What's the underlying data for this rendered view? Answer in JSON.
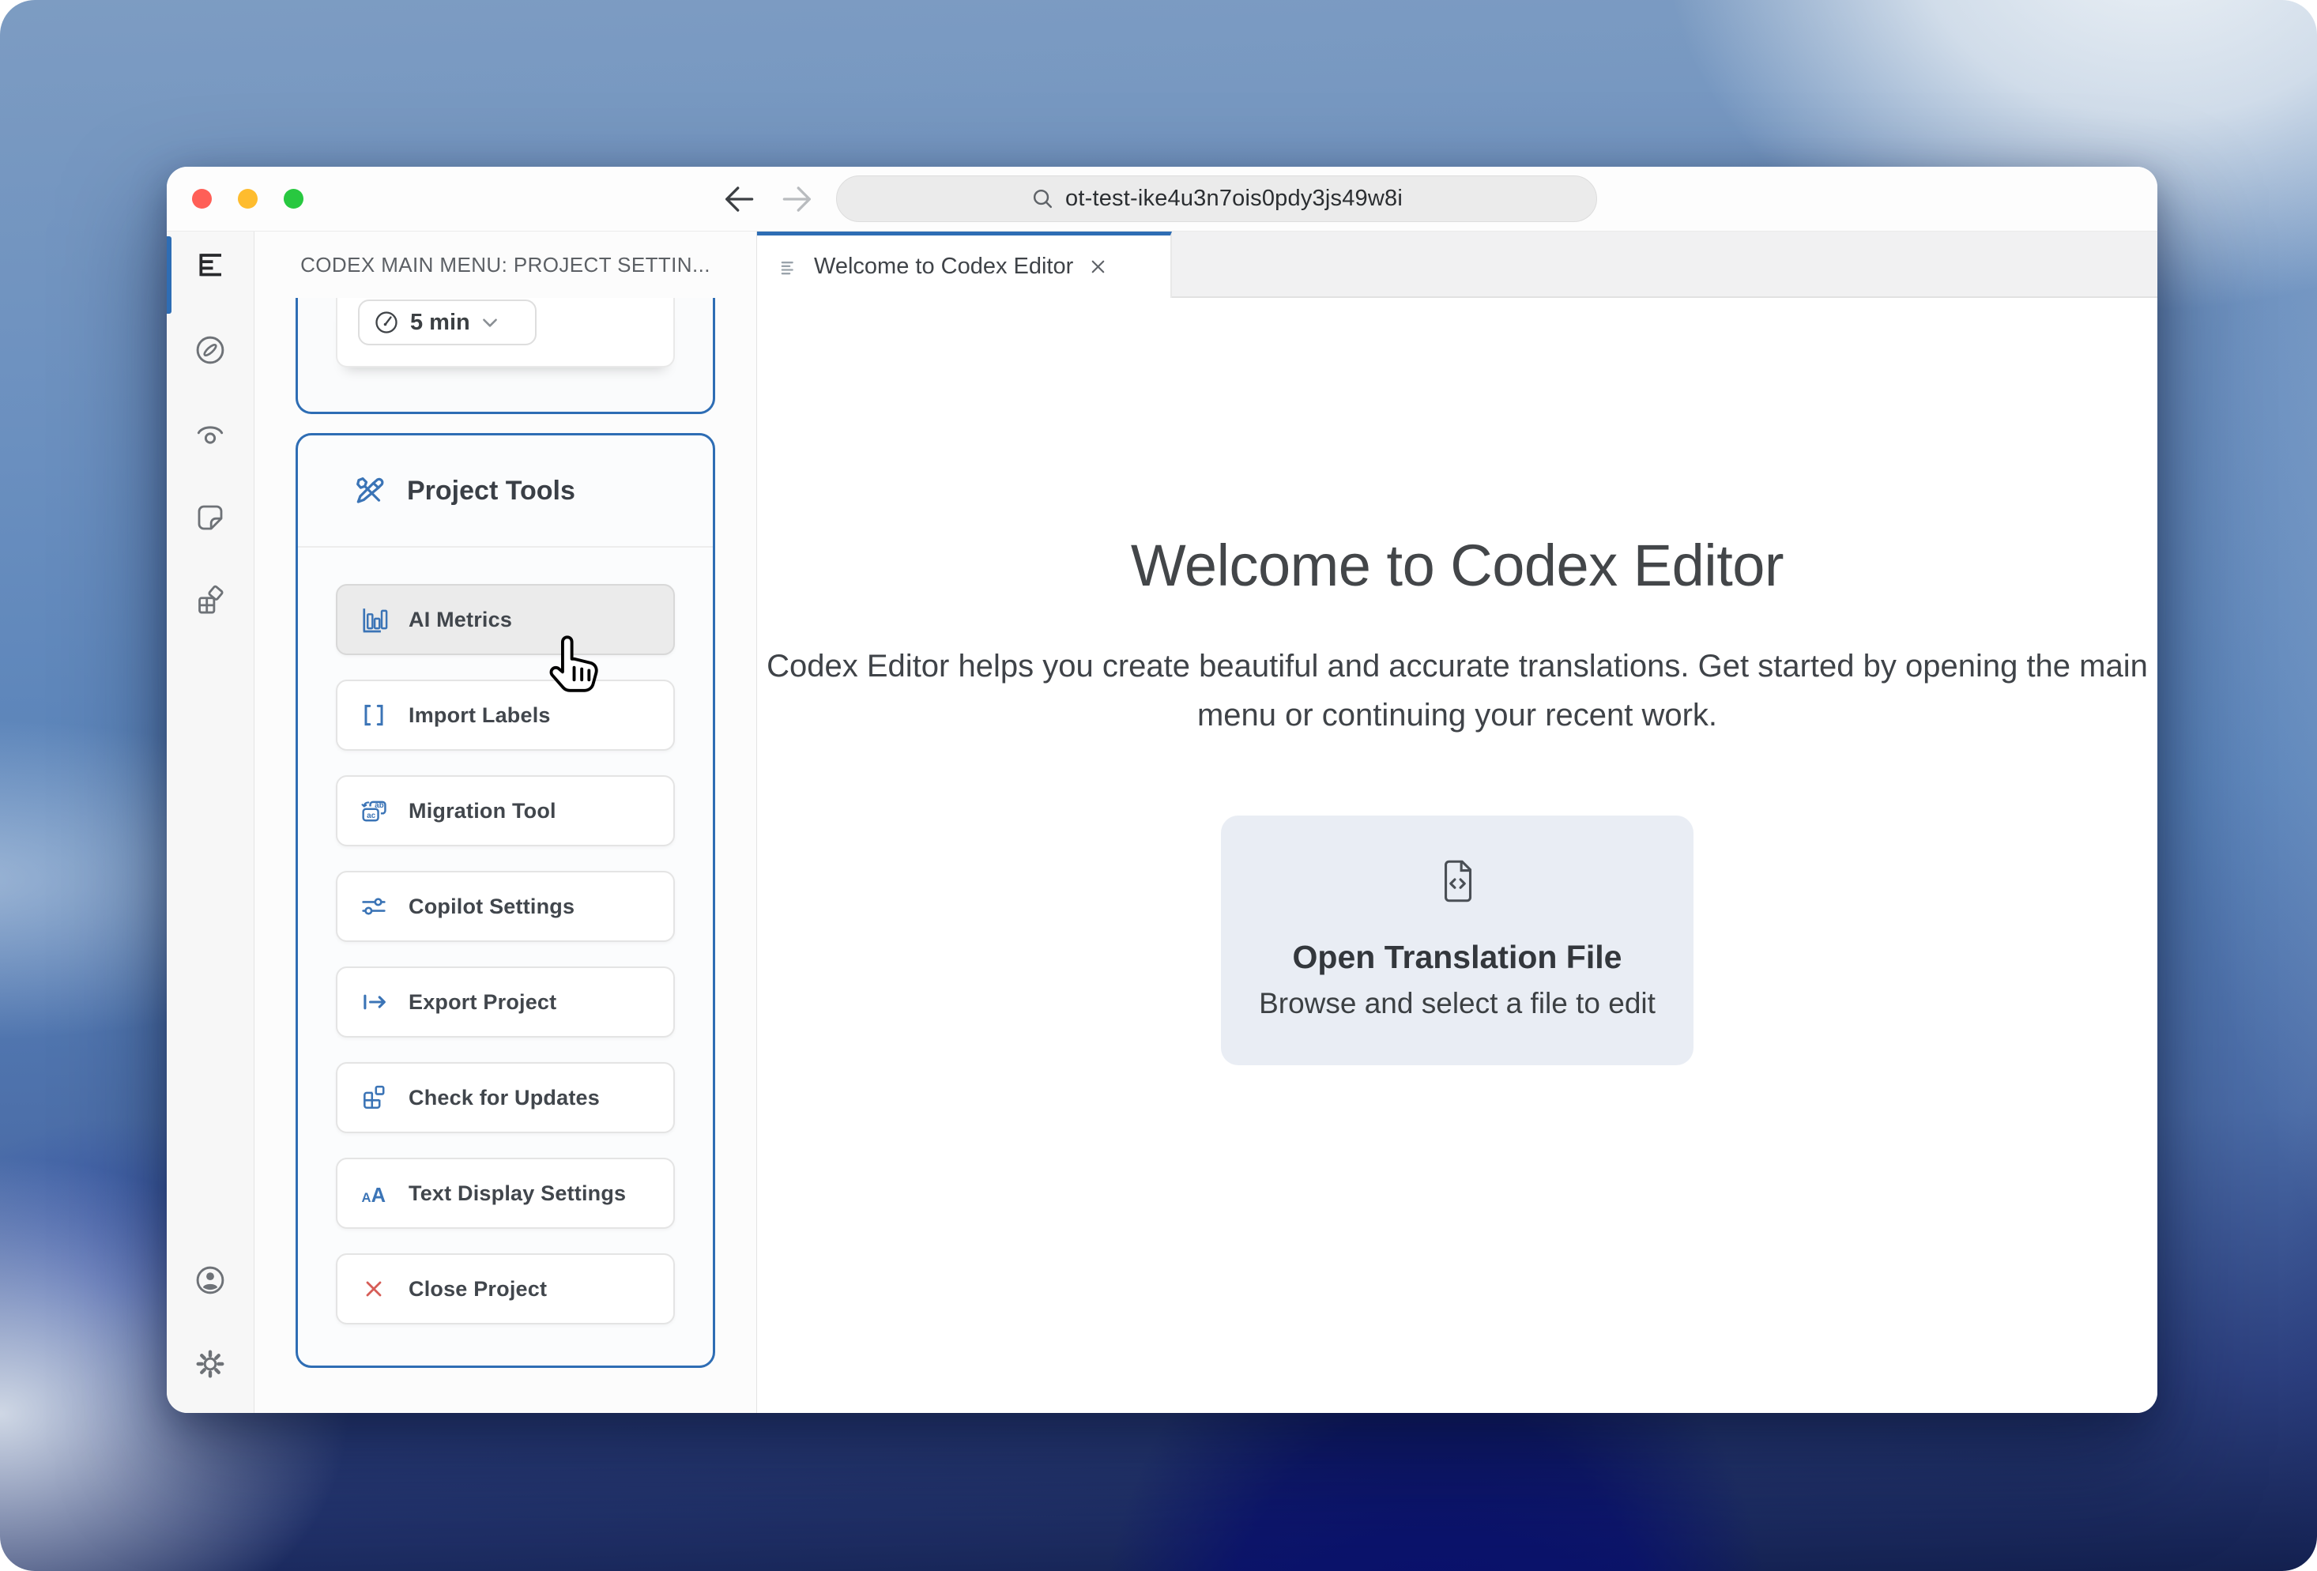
{
  "window": {
    "url": "ot-test-ike4u3n7ois0pdy3js49w8i",
    "traffic_lights": {
      "close": "#ff5f57",
      "minimize": "#febc2e",
      "zoom": "#28c840"
    }
  },
  "sidebar": {
    "items": [
      {
        "icon": "outline-tree-icon",
        "active": true
      },
      {
        "icon": "compass-icon",
        "active": false
      },
      {
        "icon": "preview-eye-icon",
        "active": false
      },
      {
        "icon": "note-icon",
        "active": false
      },
      {
        "icon": "blocks-icon",
        "active": false
      }
    ],
    "footer": [
      {
        "icon": "account-icon"
      },
      {
        "icon": "settings-gear-icon"
      }
    ]
  },
  "panel": {
    "header": "CODEX MAIN MENU: PROJECT SETTIN...",
    "settings_card": {
      "dropdown_value": "5 min",
      "dropdown_icon": "gauge-icon",
      "chevron": "chevron-down-icon"
    },
    "project_tools": {
      "title": "Project Tools",
      "header_icon": "tools-icon",
      "buttons": [
        {
          "label": "AI Metrics",
          "icon": "bar-chart-icon",
          "hovered": true
        },
        {
          "label": "Import Labels",
          "icon": "brackets-icon",
          "hovered": false
        },
        {
          "label": "Migration Tool",
          "icon": "translate-cards-icon",
          "hovered": false
        },
        {
          "label": "Copilot Settings",
          "icon": "sliders-icon",
          "hovered": false
        },
        {
          "label": "Export Project",
          "icon": "export-arrow-icon",
          "hovered": false
        },
        {
          "label": "Check for Updates",
          "icon": "update-blocks-icon",
          "hovered": false
        },
        {
          "label": "Text Display Settings",
          "icon": "font-size-icon",
          "hovered": false
        },
        {
          "label": "Close Project",
          "icon": "close-x-icon",
          "hovered": false
        }
      ]
    }
  },
  "main": {
    "tab": {
      "title": "Welcome to Codex Editor"
    },
    "heading": "Welcome to Codex Editor",
    "description": "Codex Editor helps you create beautiful and accurate translations. Get started by opening the main menu or continuing your recent work.",
    "open_card": {
      "icon": "file-code-icon",
      "title": "Open Translation File",
      "subtitle": "Browse and select a file to edit"
    }
  },
  "colors": {
    "accent_blue": "#2e6db4",
    "icon_blue": "#3b74b6",
    "close_red": "#d65d57",
    "sidebar_bg": "#f7f7f7",
    "open_card_bg": "#e9edf4"
  }
}
